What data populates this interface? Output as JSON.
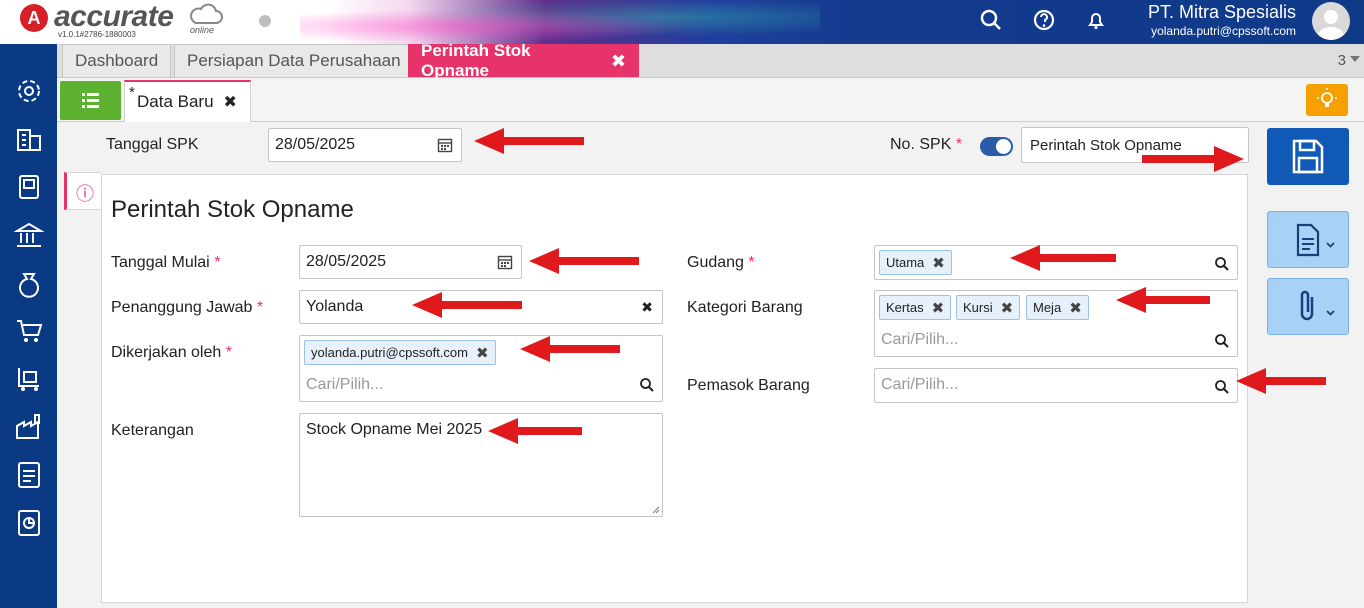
{
  "app": {
    "logo_letter": "A",
    "logo_text": "accurate",
    "version": "v1.0.1#2786-1880003",
    "online": "online",
    "company_name": "PT. Mitra Spesialis",
    "user_email": "yolanda.putri@cpssoft.com"
  },
  "tabs": [
    {
      "label": "Dashboard"
    },
    {
      "label": "Persiapan Data Perusahaan"
    },
    {
      "label": "Perintah Stok Opname",
      "close": "✖"
    }
  ],
  "tab_count": "3",
  "subtab": {
    "star": "*",
    "label": "Data Baru",
    "close": "✖"
  },
  "header_form": {
    "tanggal_spk_label": "Tanggal SPK",
    "tanggal_spk_value": "28/05/2025",
    "no_spk_label": "No. SPK",
    "required_mark": "*",
    "no_spk_value": "Perintah Stok Opname"
  },
  "panel": {
    "info_icon": "ⓘ",
    "title": "Perintah Stok Opname",
    "tanggal_mulai_label": "Tanggal Mulai",
    "tanggal_mulai_value": "28/05/2025",
    "penanggung_label": "Penanggung Jawab",
    "penanggung_value": "Yolanda",
    "clear_x": "✖",
    "dikerjakan_label": "Dikerjakan oleh",
    "dikerjakan_chip": "yolanda.putri@cpssoft.com",
    "placeholder": "Cari/Pilih...",
    "keterangan_label": "Keterangan",
    "keterangan_value": "Stock Opname Mei 2025",
    "gudang_label": "Gudang",
    "gudang_chip": "Utama",
    "kategori_label": "Kategori Barang",
    "kategori_chips": [
      "Kertas",
      "Kursi",
      "Meja"
    ],
    "pemasok_label": "Pemasok Barang"
  },
  "colors": {
    "accent": "#e6336a",
    "sidebar": "#0b3a84",
    "save": "#1159b7",
    "arrow": "#e0191c"
  }
}
